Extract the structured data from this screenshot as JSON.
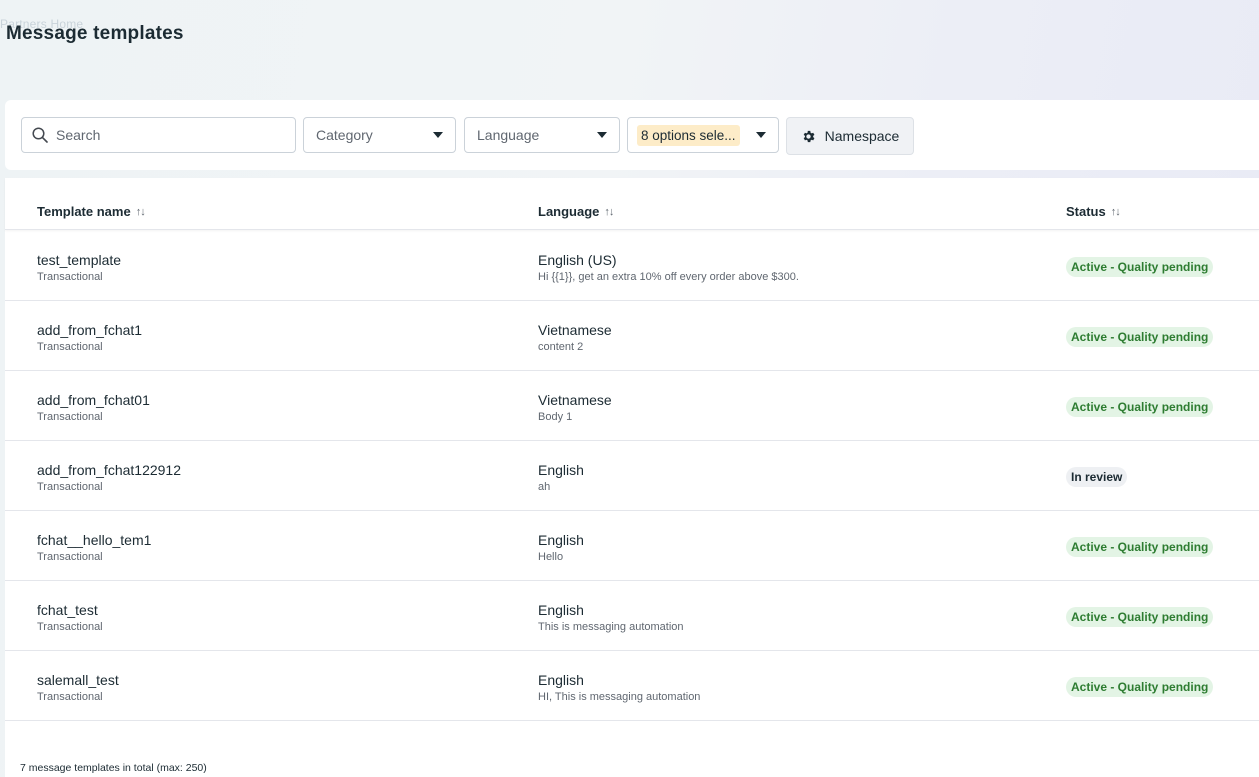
{
  "breadcrumb": "Partners Home",
  "page_title": "Message templates",
  "filters": {
    "search_placeholder": "Search",
    "category_label": "Category",
    "language_label": "Language",
    "options_label": "8 options sele...",
    "namespace_label": "Namespace"
  },
  "table": {
    "columns": {
      "name": "Template name",
      "language": "Language",
      "status": "Status",
      "sort_glyph": "↑↓"
    },
    "rows": [
      {
        "name": "test_template",
        "category": "Transactional",
        "language": "English (US)",
        "preview": "Hi {{1}}, get an extra 10% off every order above $300.",
        "status": "Active - Quality pending",
        "status_type": "active"
      },
      {
        "name": "add_from_fchat1",
        "category": "Transactional",
        "language": "Vietnamese",
        "preview": "content 2",
        "status": "Active - Quality pending",
        "status_type": "active"
      },
      {
        "name": "add_from_fchat01",
        "category": "Transactional",
        "language": "Vietnamese",
        "preview": "Body 1",
        "status": "Active - Quality pending",
        "status_type": "active"
      },
      {
        "name": "add_from_fchat122912",
        "category": "Transactional",
        "language": "English",
        "preview": "ah",
        "status": "In review",
        "status_type": "review"
      },
      {
        "name": "fchat__hello_tem1",
        "category": "Transactional",
        "language": "English",
        "preview": "Hello",
        "status": "Active - Quality pending",
        "status_type": "active"
      },
      {
        "name": "fchat_test",
        "category": "Transactional",
        "language": "English",
        "preview": "This is messaging automation",
        "status": "Active - Quality pending",
        "status_type": "active"
      },
      {
        "name": "salemall_test",
        "category": "Transactional",
        "language": "English",
        "preview": "HI, This is messaging automation",
        "status": "Active - Quality pending",
        "status_type": "active"
      }
    ]
  },
  "footer_text": "7 message templates in total (max: 250)",
  "colors": {
    "active_badge_bg": "#e3f4e5",
    "active_badge_text": "#2e7d32",
    "review_badge_bg": "#eef0f3",
    "options_chip_bg": "#fdecc8"
  },
  "icons": {
    "search": "search-icon",
    "caret": "caret-down-icon",
    "namespace": "gear-icon",
    "sort": "sort-icon"
  }
}
